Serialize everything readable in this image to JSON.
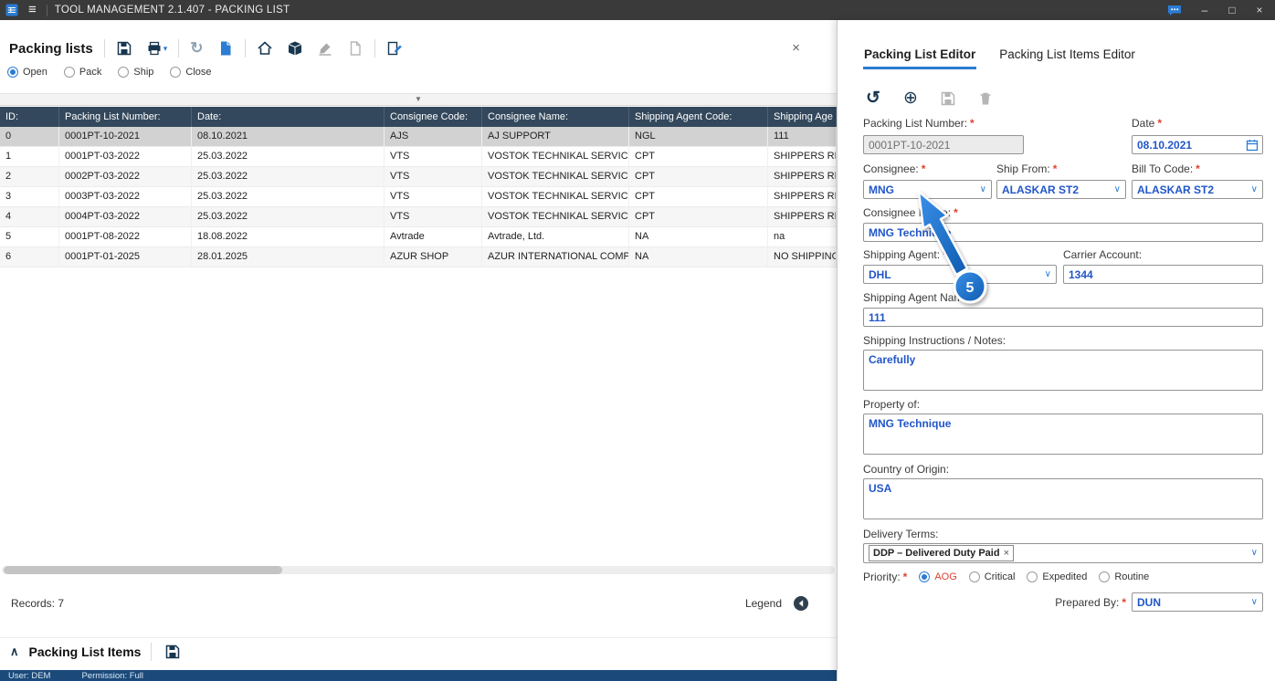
{
  "titlebar": {
    "title": "TOOL MANAGEMENT 2.1.407 - PACKING LIST"
  },
  "icons": {
    "menu": "≡",
    "minimize": "–",
    "restore": "□",
    "close": "×",
    "panel_close": "×",
    "refresh": "↻",
    "undo": "↺",
    "add": "⊕",
    "dropdown": "∨",
    "caret_down": "▾",
    "splitter_arrow": "▼",
    "collapse": "∧",
    "tag_remove": "×",
    "required": "*"
  },
  "left_panel": {
    "title": "Packing lists",
    "filters": {
      "options": [
        "Open",
        "Pack",
        "Ship",
        "Close"
      ],
      "selected": "Open"
    },
    "grid": {
      "columns": [
        "ID:",
        "Packing List Number:",
        "Date:",
        "Consignee Code:",
        "Consignee Name:",
        "Shipping Agent Code:",
        "Shipping Age"
      ],
      "rows": [
        [
          "0",
          "0001PT-10-2021",
          "08.10.2021",
          "AJS",
          "AJ SUPPORT",
          "NGL",
          "111"
        ],
        [
          "1",
          "0001PT-03-2022",
          "25.03.2022",
          "VTS",
          "VOSTOK TECHNIKAL SERVICES",
          "CPT",
          "SHIPPERS RESPO"
        ],
        [
          "2",
          "0002PT-03-2022",
          "25.03.2022",
          "VTS",
          "VOSTOK TECHNIKAL SERVICES",
          "CPT",
          "SHIPPERS RESPO"
        ],
        [
          "3",
          "0003PT-03-2022",
          "25.03.2022",
          "VTS",
          "VOSTOK TECHNIKAL SERVICES",
          "CPT",
          "SHIPPERS RESPO"
        ],
        [
          "4",
          "0004PT-03-2022",
          "25.03.2022",
          "VTS",
          "VOSTOK TECHNIKAL SERVICES",
          "CPT",
          "SHIPPERS RESPO"
        ],
        [
          "5",
          "0001PT-08-2022",
          "18.08.2022",
          "Avtrade",
          "Avtrade, Ltd.",
          "NA",
          "na"
        ],
        [
          "6",
          "0001PT-01-2025",
          "28.01.2025",
          "AZUR SHOP",
          "AZUR INTERNATIONAL COMP...",
          "NA",
          "NO SHIPPING A"
        ]
      ],
      "selected_row": 0
    },
    "records_label": "Records: 7",
    "legend_label": "Legend",
    "items_header": "Packing List Items"
  },
  "editor": {
    "tabs": [
      {
        "label": "Packing List Editor"
      },
      {
        "label": "Packing List Items Editor"
      }
    ],
    "active_tab": "Packing List Editor",
    "fields": {
      "packing_list_number": {
        "label": "Packing List Number:",
        "value": "0001PT-10-2021",
        "disabled": true
      },
      "date": {
        "label": "Date",
        "value": "08.10.2021"
      },
      "consignee": {
        "label": "Consignee:",
        "value": "MNG"
      },
      "ship_from": {
        "label": "Ship From:",
        "value": "ALASKAR ST2"
      },
      "bill_to": {
        "label": "Bill To Code:",
        "value": "ALASKAR ST2"
      },
      "consignee_name": {
        "label": "Consignee Name:",
        "value": "MNG Technique"
      },
      "shipping_agent": {
        "label": "Shipping Agent:",
        "value": "DHL"
      },
      "carrier_account": {
        "label": "Carrier Account:",
        "value": "1344"
      },
      "shipping_agent_name": {
        "label": "Shipping Agent Name:",
        "value": "111"
      },
      "shipping_instructions": {
        "label": "Shipping Instructions / Notes:",
        "value": "Carefully"
      },
      "property_of": {
        "label": "Property of:",
        "value": "MNG Technique"
      },
      "country_of_origin": {
        "label": "Country of Origin:",
        "value": "USA"
      },
      "delivery_terms": {
        "label": "Delivery Terms:",
        "tag": "DDP – Delivered Duty Paid"
      },
      "priority": {
        "label": "Priority:",
        "options": [
          "AOG",
          "Critical",
          "Expedited",
          "Routine"
        ],
        "selected": "AOG"
      },
      "prepared_by": {
        "label": "Prepared By:",
        "value": "DUN"
      }
    }
  },
  "statusbar": {
    "user": "User: DEM",
    "permission": "Permission: Full"
  },
  "annotation": {
    "step": "5"
  },
  "colors": {
    "accent": "#2b7cd3",
    "value_text": "#2156c8",
    "required": "#e0402e",
    "grid_header": "#33485c",
    "titlebar": "#3a3a3a",
    "statusbar": "#1b4a7a",
    "annotation_blue": "#1777d2"
  }
}
